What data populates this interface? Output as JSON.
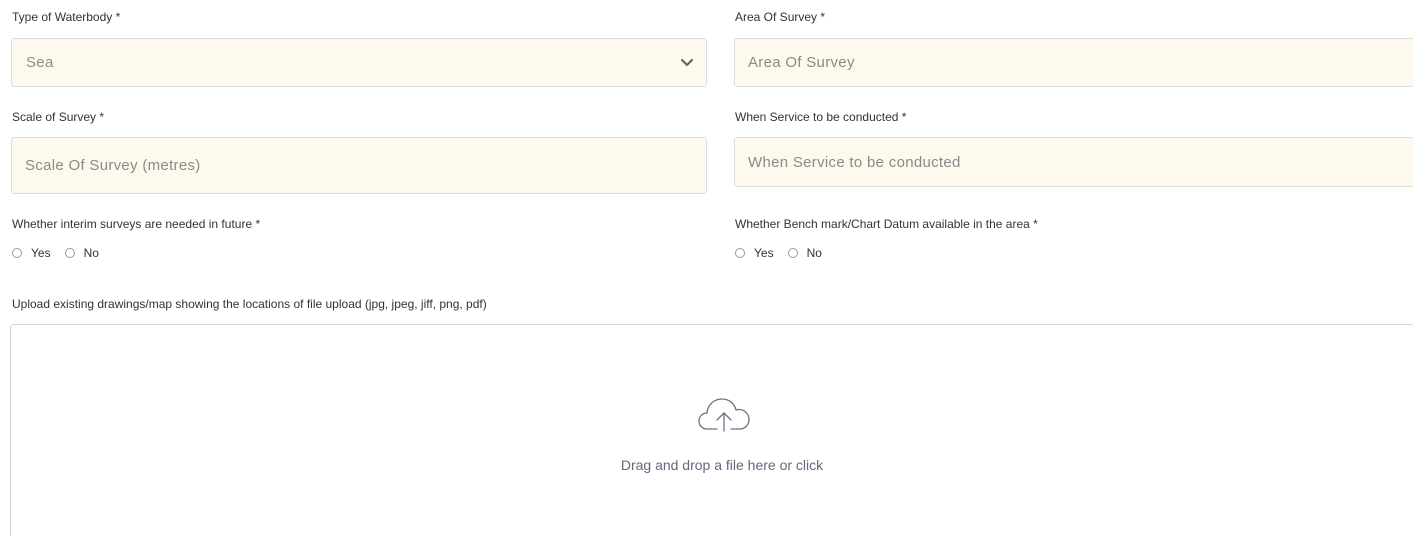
{
  "waterbody": {
    "label": "Type of Waterbody *",
    "selected": "Sea"
  },
  "area_of_survey": {
    "label": "Area Of Survey *",
    "placeholder": "Area Of Survey"
  },
  "scale_of_survey": {
    "label": "Scale of Survey *",
    "placeholder": "Scale Of Survey (metres)"
  },
  "service_time": {
    "label": "When Service to be conducted *",
    "placeholder": "When Service to be conducted"
  },
  "interim_surveys": {
    "label": "Whether interim surveys are needed in future *",
    "options": [
      "Yes",
      "No"
    ]
  },
  "bench_mark": {
    "label": "Whether Bench mark/Chart Datum available in the area *",
    "options": [
      "Yes",
      "No"
    ]
  },
  "upload": {
    "label": "Upload existing drawings/map showing the locations of file upload (jpg, jpeg, jiff, png, pdf)",
    "prompt": "Drag and drop a file here or click",
    "icon": "cloud-upload-icon"
  },
  "colors": {
    "input_background": "#fdf9ec",
    "input_border": "#dcdcdc",
    "placeholder_text": "#8a8a8a",
    "dropzone_text": "#5f6b7a"
  }
}
